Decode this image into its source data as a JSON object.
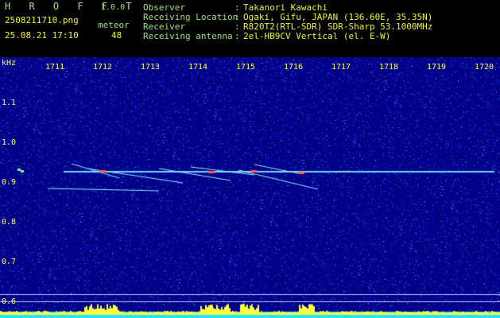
{
  "header": {
    "app_title": "H R O F F T",
    "version": "1.0.0",
    "file_name": "2508211710.png",
    "datetime": "25.08.21 17:10",
    "meteor_label": "meteor",
    "meteor_count": "48",
    "info": [
      {
        "label": "Observer",
        "sep": ":",
        "value": "Takanori Kawachi"
      },
      {
        "label": "Receiving Location",
        "sep": ":",
        "value": "Ogaki, Gifu, JAPAN (136.60E, 35.35N)"
      },
      {
        "label": "Receiver",
        "sep": ":",
        "value": "R820T2(RTL-SDR) SDR-Sharp 53.1000MHz"
      },
      {
        "label": "Receiving antenna",
        "sep": ":",
        "value": "2el-HB9CV Vertical (el. E-W)"
      }
    ]
  },
  "axis": {
    "unit": "kHz",
    "freq_ticks": [
      "1.1",
      "1.0",
      "0.9",
      "0.8",
      "0.7",
      "0.6"
    ],
    "time_ticks": [
      "1711",
      "1712",
      "1713",
      "1714",
      "1715",
      "1716",
      "1717",
      "1718",
      "1719",
      "1720"
    ]
  },
  "colors": {
    "header_text": "#9fe37a",
    "header_values": "#f2f23a",
    "axis_text": "#ffff55",
    "background": "#000080",
    "carrier": "#6fd6ff",
    "baseline_bar": "#22e6ff",
    "noise_peak": "#ffff40"
  }
}
